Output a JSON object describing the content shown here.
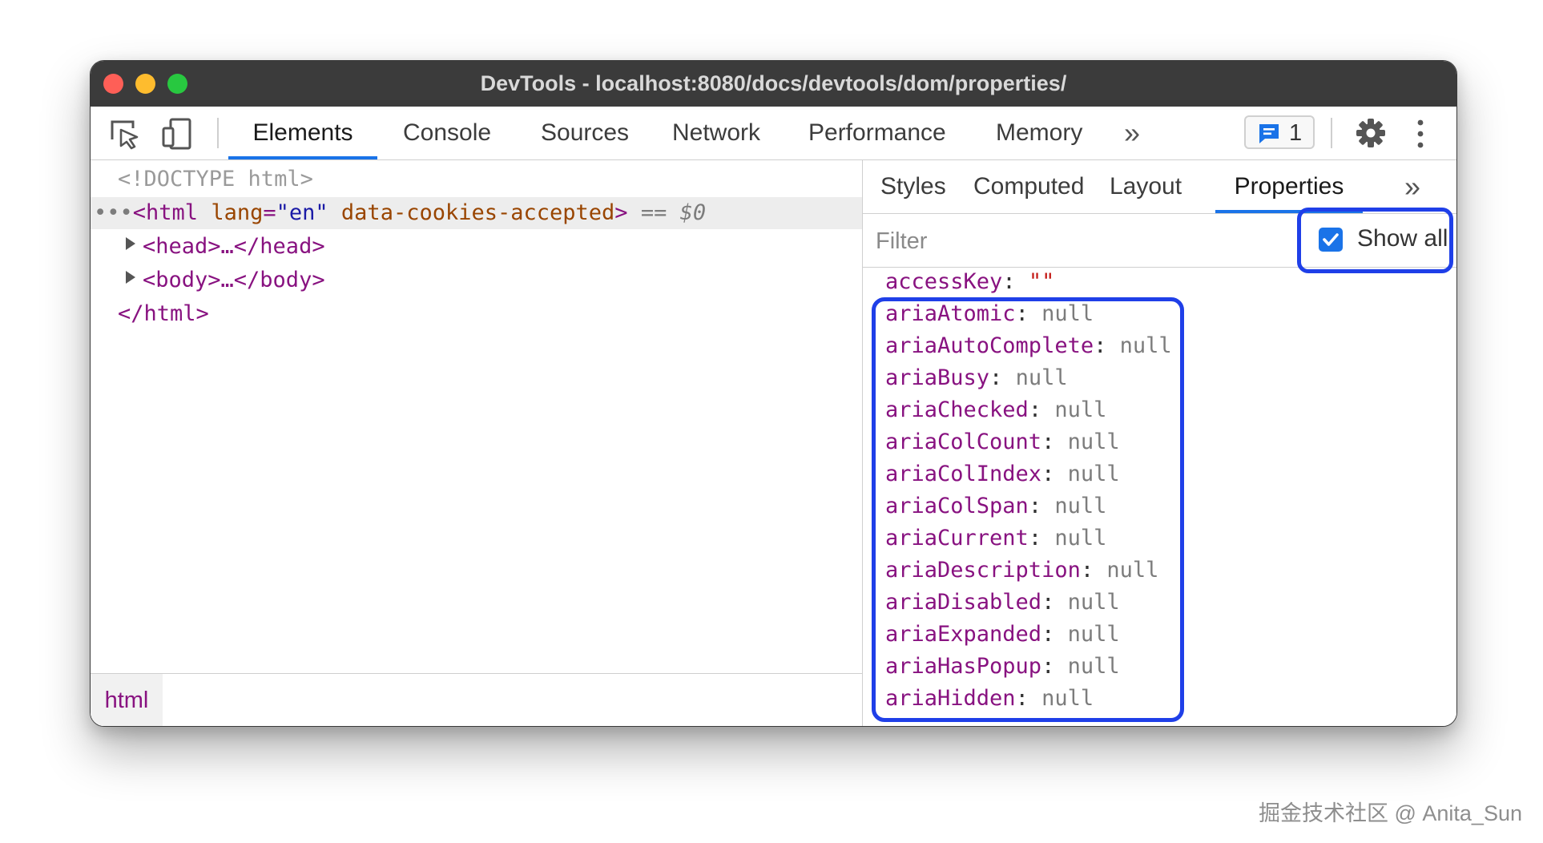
{
  "window": {
    "title": "DevTools - localhost:8080/docs/devtools/dom/properties/"
  },
  "toolbar": {
    "tabs": [
      "Elements",
      "Console",
      "Sources",
      "Network",
      "Performance",
      "Memory"
    ],
    "active_tab": "Elements",
    "more_label": "»",
    "issues_count": "1"
  },
  "elements_panel": {
    "doctype": "<!DOCTYPE html>",
    "html_open": {
      "dots": "•••",
      "tag_open": "<html",
      "attr1_name": "lang",
      "attr1_eq": "=",
      "attr1_value": "\"en\"",
      "attr2_name": "data-cookies-accepted",
      "tag_close": ">",
      "eq_marker": "==",
      "dollar": "$0"
    },
    "head": "<head>…</head>",
    "body": "<body>…</body>",
    "html_close": "</html>",
    "breadcrumb": "html"
  },
  "sidebar": {
    "tabs": [
      "Styles",
      "Computed",
      "Layout",
      "Properties"
    ],
    "active_tab": "Properties",
    "more_label": "»",
    "filter_placeholder": "Filter",
    "show_all_label": "Show all",
    "show_all_checked": true,
    "properties": [
      {
        "key": "accessKey",
        "value": "\"\""
      },
      {
        "key": "ariaAtomic",
        "value": "null"
      },
      {
        "key": "ariaAutoComplete",
        "value": "null"
      },
      {
        "key": "ariaBusy",
        "value": "null"
      },
      {
        "key": "ariaChecked",
        "value": "null"
      },
      {
        "key": "ariaColCount",
        "value": "null"
      },
      {
        "key": "ariaColIndex",
        "value": "null"
      },
      {
        "key": "ariaColSpan",
        "value": "null"
      },
      {
        "key": "ariaCurrent",
        "value": "null"
      },
      {
        "key": "ariaDescription",
        "value": "null"
      },
      {
        "key": "ariaDisabled",
        "value": "null"
      },
      {
        "key": "ariaExpanded",
        "value": "null"
      },
      {
        "key": "ariaHasPopup",
        "value": "null"
      },
      {
        "key": "ariaHidden",
        "value": "null"
      }
    ]
  },
  "watermark": "掘金技术社区 @ Anita_Sun",
  "colors": {
    "accent": "#1a73e8",
    "highlight_box": "#1f3fe8",
    "tag": "#881280",
    "attr_name": "#994500",
    "attr_value": "#1a1aa6"
  }
}
